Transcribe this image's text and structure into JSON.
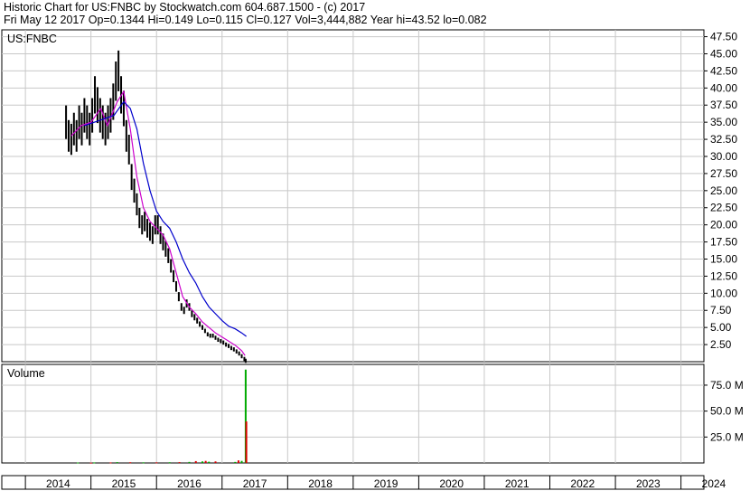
{
  "header": {
    "line1": "Historic Chart for US:FNBC by Stockwatch.com 604.687.1500 - (c) 2017",
    "line2": "Fri May 12 2017   Op=0.1344   Hi=0.149   Lo=0.115   Cl=0.127   Vol=3,444,882   Year hi=43.52   lo=0.082"
  },
  "chart_data": [
    {
      "type": "line",
      "title": "US:FNBC",
      "ylim": [
        0,
        48.5
      ],
      "yticks": [
        "47.50",
        "45.00",
        "42.50",
        "40.00",
        "37.50",
        "35.00",
        "32.50",
        "30.00",
        "27.50",
        "25.00",
        "22.50",
        "20.00",
        "17.50",
        "15.00",
        "12.50",
        "10.00",
        "7.50",
        "5.00",
        "2.50"
      ],
      "series": [
        {
          "style": "ohlc-bars",
          "color": "#000000",
          "x": [
            2014.62,
            2014.66,
            2014.7,
            2014.74,
            2014.78,
            2014.82,
            2014.86,
            2014.9,
            2014.94,
            2014.98,
            2015.02,
            2015.06,
            2015.1,
            2015.14,
            2015.18,
            2015.22,
            2015.26,
            2015.3,
            2015.34,
            2015.38,
            2015.42,
            2015.46,
            2015.5,
            2015.54,
            2015.58,
            2015.62,
            2015.66,
            2015.7,
            2015.74,
            2015.78,
            2015.82,
            2015.86,
            2015.9,
            2015.94,
            2015.98,
            2016.02,
            2016.06,
            2016.1,
            2016.14,
            2016.18,
            2016.22,
            2016.26,
            2016.3,
            2016.34,
            2016.38,
            2016.42,
            2016.46,
            2016.5,
            2016.54,
            2016.58,
            2016.62,
            2016.66,
            2016.7,
            2016.74,
            2016.78,
            2016.82,
            2016.86,
            2016.9,
            2016.94,
            2016.98,
            2017.02,
            2017.06,
            2017.1,
            2017.14,
            2017.18,
            2017.22,
            2017.26,
            2017.3,
            2017.34,
            2017.36
          ],
          "values": [
            35,
            33,
            32.5,
            34,
            33,
            35,
            34,
            36,
            35,
            34,
            36,
            39,
            37.5,
            36,
            35,
            34,
            35,
            36,
            38,
            41,
            42.5,
            39,
            37,
            33,
            31,
            27,
            25,
            23,
            21,
            20,
            20.5,
            19.5,
            19,
            18.5,
            20,
            20,
            18.5,
            17.5,
            16.5,
            15.5,
            14,
            12.5,
            11,
            9.5,
            8,
            7.5,
            8.5,
            8,
            7,
            6.5,
            6,
            5.5,
            5,
            4.5,
            4,
            3.8,
            3.8,
            3.5,
            3.2,
            3.0,
            2.8,
            2.5,
            2.3,
            2.0,
            1.8,
            1.5,
            1.2,
            0.8,
            0.4,
            0.13
          ]
        },
        {
          "name": "",
          "color": "#cc00cc",
          "style": "moving-average-short",
          "x": [
            2014.7,
            2014.85,
            2015.0,
            2015.15,
            2015.25,
            2015.4,
            2015.5,
            2015.6,
            2015.7,
            2015.8,
            2015.9,
            2016.0,
            2016.1,
            2016.2,
            2016.3,
            2016.4,
            2016.5,
            2016.6,
            2016.7,
            2016.8,
            2016.9,
            2017.0,
            2017.1,
            2017.2,
            2017.3,
            2017.35
          ],
          "values": [
            33,
            34.5,
            35,
            37,
            34.5,
            38,
            39.5,
            34,
            27,
            22.5,
            20.5,
            19.5,
            18.5,
            16.5,
            13,
            9.5,
            8,
            7,
            5.8,
            5,
            4.2,
            3.6,
            3.0,
            2.4,
            1.6,
            0.9
          ]
        },
        {
          "name": "",
          "color": "#0000cc",
          "style": "moving-average-long",
          "x": [
            2014.9,
            2015.05,
            2015.2,
            2015.35,
            2015.5,
            2015.6,
            2015.7,
            2015.8,
            2015.9,
            2016.0,
            2016.1,
            2016.2,
            2016.3,
            2016.4,
            2016.5,
            2016.6,
            2016.7,
            2016.8,
            2016.9,
            2017.0,
            2017.1,
            2017.2,
            2017.3,
            2017.37
          ],
          "values": [
            34.5,
            35,
            35.5,
            36,
            38,
            37,
            34,
            29,
            25,
            22,
            20.5,
            19.5,
            17.5,
            15,
            13,
            11.5,
            9.5,
            8,
            7,
            6,
            5.2,
            4.8,
            4.2,
            3.7
          ]
        }
      ]
    },
    {
      "type": "bar",
      "title": "Volume",
      "ylim": [
        0,
        95
      ],
      "yticks": [
        "75.0 M",
        "50.0 M",
        "25.0 M"
      ],
      "series": [
        {
          "name": "",
          "color": "#00aa00",
          "x": [
            2014.8,
            2015.05,
            2015.4,
            2015.8,
            2016.2,
            2016.5,
            2016.7,
            2016.8,
            2017.2,
            2017.3,
            2017.36
          ],
          "values": [
            0.4,
            0.5,
            0.8,
            0.6,
            0.7,
            1.0,
            1.5,
            1.2,
            1.0,
            2.0,
            90
          ]
        },
        {
          "name": "",
          "color": "#dd0000",
          "x": [
            2015.0,
            2015.3,
            2015.6,
            2016.0,
            2016.35,
            2016.6,
            2016.75,
            2016.9,
            2017.25,
            2017.37
          ],
          "values": [
            0.3,
            0.5,
            0.7,
            0.6,
            0.8,
            1.8,
            2.0,
            1.5,
            2.5,
            40
          ]
        }
      ]
    }
  ],
  "x_axis": {
    "range": [
      2013.64,
      2024.35
    ],
    "ticks": [
      2014,
      2015,
      2016,
      2017,
      2018,
      2019,
      2020,
      2021,
      2022,
      2023,
      2024
    ],
    "labels": [
      "2014",
      "2015",
      "2016",
      "2017",
      "2018",
      "2019",
      "2020",
      "2021",
      "2022",
      "2023",
      "2024"
    ]
  }
}
